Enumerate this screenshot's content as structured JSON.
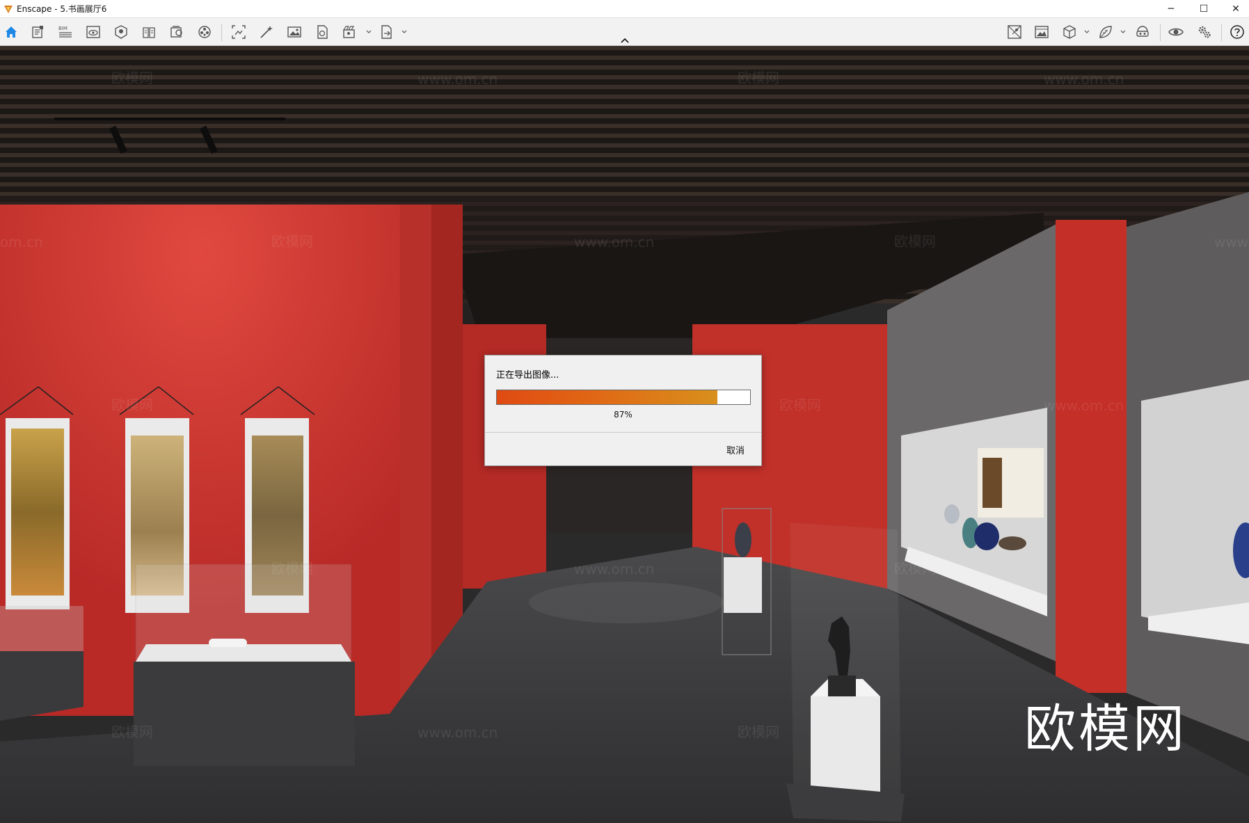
{
  "window": {
    "title": "Enscape - 5.书画展厅6",
    "minimize_glyph": "─",
    "maximize_glyph": "☐",
    "close_glyph": "✕"
  },
  "toolbar": {
    "left_icons": [
      "home-icon",
      "project-icon",
      "bim-icon",
      "view-icon",
      "map-icon",
      "book-icon",
      "asset-library-icon",
      "material-editor-icon",
      "screenshot-icon",
      "batch-render-icon",
      "image-icon",
      "panorama-icon",
      "video-icon",
      "export-icon"
    ],
    "right_icons": [
      "map-view-icon",
      "landscape-icon",
      "cube-icon",
      "leaf-icon",
      "vr-headset-icon",
      "eye-icon",
      "settings-icon",
      "help-icon"
    ],
    "bim_label": "BIM"
  },
  "dialog": {
    "title": "正在导出图像...",
    "progress": 0.87,
    "percent_label": "87%",
    "cancel_label": "取消"
  },
  "watermark": {
    "brand": "欧模网",
    "site": "www.om.cn",
    "partial_left": "om.cn",
    "partial_right": "www."
  },
  "colors": {
    "accent": "#1e88e5",
    "wall_red": "#c9302c",
    "progress_start": "#df4a12",
    "progress_end": "#d8901c"
  }
}
